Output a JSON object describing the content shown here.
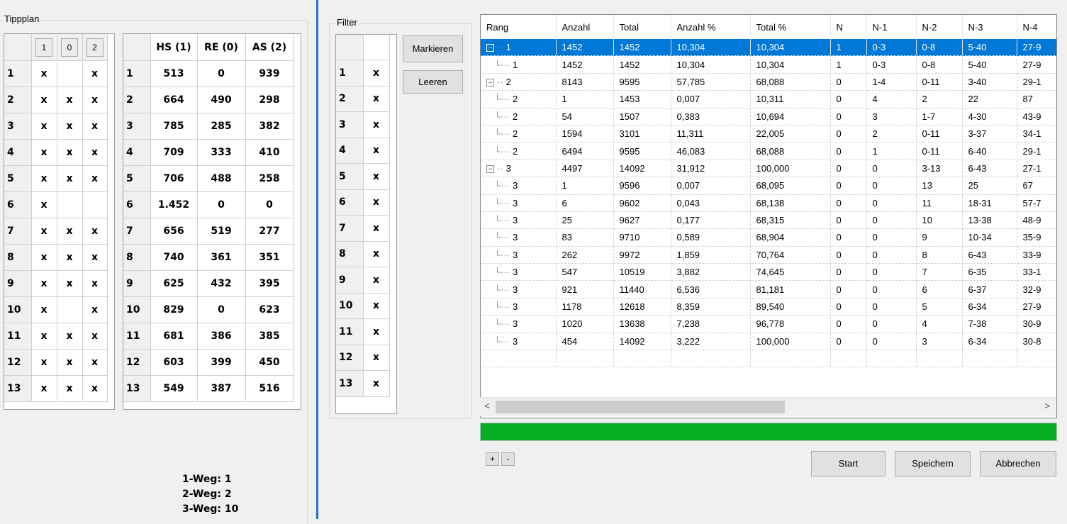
{
  "tippplan": {
    "label": "Tippplan",
    "header_buttons": [
      "1",
      "0",
      "2"
    ],
    "rows": [
      {
        "n": "1",
        "c1": "x",
        "c0": "",
        "c2": "x"
      },
      {
        "n": "2",
        "c1": "x",
        "c0": "x",
        "c2": "x"
      },
      {
        "n": "3",
        "c1": "x",
        "c0": "x",
        "c2": "x"
      },
      {
        "n": "4",
        "c1": "x",
        "c0": "x",
        "c2": "x"
      },
      {
        "n": "5",
        "c1": "x",
        "c0": "x",
        "c2": "x"
      },
      {
        "n": "6",
        "c1": "x",
        "c0": "",
        "c2": ""
      },
      {
        "n": "7",
        "c1": "x",
        "c0": "x",
        "c2": "x"
      },
      {
        "n": "8",
        "c1": "x",
        "c0": "x",
        "c2": "x"
      },
      {
        "n": "9",
        "c1": "x",
        "c0": "x",
        "c2": "x"
      },
      {
        "n": "10",
        "c1": "x",
        "c0": "",
        "c2": "x"
      },
      {
        "n": "11",
        "c1": "x",
        "c0": "x",
        "c2": "x"
      },
      {
        "n": "12",
        "c1": "x",
        "c0": "x",
        "c2": "x"
      },
      {
        "n": "13",
        "c1": "x",
        "c0": "x",
        "c2": "x"
      }
    ]
  },
  "stats": {
    "headers": [
      "HS (1)",
      "RE (0)",
      "AS (2)"
    ],
    "rows": [
      {
        "n": "1",
        "hs": "513",
        "re": "0",
        "as": "939"
      },
      {
        "n": "2",
        "hs": "664",
        "re": "490",
        "as": "298"
      },
      {
        "n": "3",
        "hs": "785",
        "re": "285",
        "as": "382"
      },
      {
        "n": "4",
        "hs": "709",
        "re": "333",
        "as": "410"
      },
      {
        "n": "5",
        "hs": "706",
        "re": "488",
        "as": "258"
      },
      {
        "n": "6",
        "hs": "1.452",
        "re": "0",
        "as": "0"
      },
      {
        "n": "7",
        "hs": "656",
        "re": "519",
        "as": "277"
      },
      {
        "n": "8",
        "hs": "740",
        "re": "361",
        "as": "351"
      },
      {
        "n": "9",
        "hs": "625",
        "re": "432",
        "as": "395"
      },
      {
        "n": "10",
        "hs": "829",
        "re": "0",
        "as": "623"
      },
      {
        "n": "11",
        "hs": "681",
        "re": "386",
        "as": "385"
      },
      {
        "n": "12",
        "hs": "603",
        "re": "399",
        "as": "450"
      },
      {
        "n": "13",
        "hs": "549",
        "re": "387",
        "as": "516"
      }
    ]
  },
  "weg": [
    "1-Weg: 1",
    "2-Weg: 2",
    "3-Weg: 10"
  ],
  "filter": {
    "label": "Filter",
    "rows": [
      {
        "n": "1",
        "v": "x"
      },
      {
        "n": "2",
        "v": "x"
      },
      {
        "n": "3",
        "v": "x"
      },
      {
        "n": "4",
        "v": "x"
      },
      {
        "n": "5",
        "v": "x"
      },
      {
        "n": "6",
        "v": "x"
      },
      {
        "n": "7",
        "v": "x"
      },
      {
        "n": "8",
        "v": "x"
      },
      {
        "n": "9",
        "v": "x"
      },
      {
        "n": "10",
        "v": "x"
      },
      {
        "n": "11",
        "v": "x"
      },
      {
        "n": "12",
        "v": "x"
      },
      {
        "n": "13",
        "v": "x"
      }
    ],
    "markieren_label": "Markieren",
    "leeren_label": "Leeren"
  },
  "tree": {
    "columns": [
      "Rang",
      "Anzahl",
      "Total",
      "Anzahl %",
      "Total %",
      "N",
      "N-1",
      "N-2",
      "N-3",
      "N-4"
    ],
    "rows": [
      {
        "level": 0,
        "expander": "−",
        "selected": true,
        "cells": [
          "1",
          "1452",
          "1452",
          "10,304",
          "10,304",
          "1",
          "0-3",
          "0-8",
          "5-40",
          "27-9"
        ]
      },
      {
        "level": 1,
        "cells": [
          "1",
          "1452",
          "1452",
          "10,304",
          "10,304",
          "1",
          "0-3",
          "0-8",
          "5-40",
          "27-9"
        ]
      },
      {
        "level": 0,
        "expander": "−",
        "cells": [
          "2",
          "8143",
          "9595",
          "57,785",
          "68,088",
          "0",
          "1-4",
          "0-11",
          "3-40",
          "29-1"
        ]
      },
      {
        "level": 1,
        "cells": [
          "2",
          "1",
          "1453",
          "0,007",
          "10,311",
          "0",
          "4",
          "2",
          "22",
          "87"
        ]
      },
      {
        "level": 1,
        "cells": [
          "2",
          "54",
          "1507",
          "0,383",
          "10,694",
          "0",
          "3",
          "1-7",
          "4-30",
          "43-9"
        ]
      },
      {
        "level": 1,
        "cells": [
          "2",
          "1594",
          "3101",
          "11,311",
          "22,005",
          "0",
          "2",
          "0-11",
          "3-37",
          "34-1"
        ]
      },
      {
        "level": 1,
        "cells": [
          "2",
          "6494",
          "9595",
          "46,083",
          "68,088",
          "0",
          "1",
          "0-11",
          "6-40",
          "29-1"
        ]
      },
      {
        "level": 0,
        "expander": "−",
        "cells": [
          "3",
          "4497",
          "14092",
          "31,912",
          "100,000",
          "0",
          "0",
          "3-13",
          "6-43",
          "27-1"
        ]
      },
      {
        "level": 1,
        "cells": [
          "3",
          "1",
          "9596",
          "0,007",
          "68,095",
          "0",
          "0",
          "13",
          "25",
          "67"
        ]
      },
      {
        "level": 1,
        "cells": [
          "3",
          "6",
          "9602",
          "0,043",
          "68,138",
          "0",
          "0",
          "11",
          "18-31",
          "57-7"
        ]
      },
      {
        "level": 1,
        "cells": [
          "3",
          "25",
          "9627",
          "0,177",
          "68,315",
          "0",
          "0",
          "10",
          "13-38",
          "48-9"
        ]
      },
      {
        "level": 1,
        "cells": [
          "3",
          "83",
          "9710",
          "0,589",
          "68,904",
          "0",
          "0",
          "9",
          "10-34",
          "35-9"
        ]
      },
      {
        "level": 1,
        "cells": [
          "3",
          "262",
          "9972",
          "1,859",
          "70,764",
          "0",
          "0",
          "8",
          "6-43",
          "33-9"
        ]
      },
      {
        "level": 1,
        "cells": [
          "3",
          "547",
          "10519",
          "3,882",
          "74,645",
          "0",
          "0",
          "7",
          "6-35",
          "33-1"
        ]
      },
      {
        "level": 1,
        "cells": [
          "3",
          "921",
          "11440",
          "6,536",
          "81,181",
          "0",
          "0",
          "6",
          "6-37",
          "32-9"
        ]
      },
      {
        "level": 1,
        "cells": [
          "3",
          "1178",
          "12618",
          "8,359",
          "89,540",
          "0",
          "0",
          "5",
          "6-34",
          "27-9"
        ]
      },
      {
        "level": 1,
        "cells": [
          "3",
          "1020",
          "13638",
          "7,238",
          "96,778",
          "0",
          "0",
          "4",
          "7-38",
          "30-9"
        ]
      },
      {
        "level": 1,
        "cells": [
          "3",
          "454",
          "14092",
          "3,222",
          "100,000",
          "0",
          "0",
          "3",
          "6-34",
          "30-8"
        ]
      }
    ]
  },
  "progress": 1.0,
  "colors": {
    "progress": "#06b025",
    "selection": "#0078d7"
  },
  "buttons": {
    "plus": "+",
    "minus": "-",
    "start": "Start",
    "speichern": "Speichern",
    "abbrechen": "Abbrechen",
    "scroll_left": "<",
    "scroll_right": ">"
  }
}
